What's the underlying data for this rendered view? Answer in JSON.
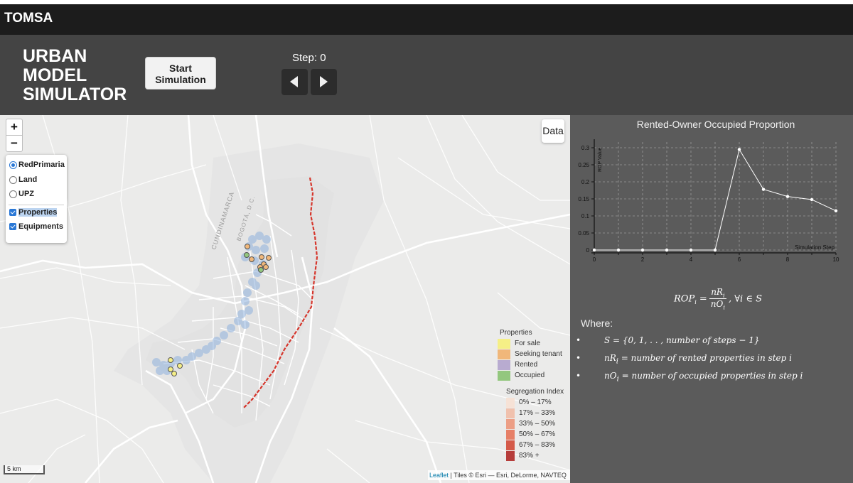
{
  "brand": "TOMSA",
  "app_title": [
    "URBAN",
    "MODEL",
    "SIMULATOR"
  ],
  "start_button": [
    "Start",
    "Simulation"
  ],
  "step_label": "Step: 0",
  "zoom": {
    "in": "+",
    "out": "−"
  },
  "layers": {
    "base": [
      {
        "label": "RedPrimaria",
        "selected": true
      },
      {
        "label": "Land",
        "selected": false
      },
      {
        "label": "UPZ",
        "selected": false
      }
    ],
    "overlays": [
      {
        "label": "Properties",
        "checked": true
      },
      {
        "label": "Equipments",
        "checked": true
      }
    ]
  },
  "data_button": "Data",
  "map_labels": {
    "region": "CUNDINAMARCA",
    "city": "BOGOTÁ, D.C."
  },
  "legend": {
    "properties_title": "Properties",
    "properties": [
      {
        "label": "For sale",
        "color": "#f5ef86"
      },
      {
        "label": "Seeking tenant",
        "color": "#f0b77a"
      },
      {
        "label": "Rented",
        "color": "#b8abd0"
      },
      {
        "label": "Occupied",
        "color": "#93c77e"
      }
    ],
    "segregation_title": "Segregation Index",
    "segregation": [
      {
        "label": "0% – 17%",
        "color": "#f6e2d6"
      },
      {
        "label": "17% – 33%",
        "color": "#f0c1ad"
      },
      {
        "label": "33% – 50%",
        "color": "#ec9e85"
      },
      {
        "label": "50% – 67%",
        "color": "#e67f66"
      },
      {
        "label": "67% – 83%",
        "color": "#d45a49"
      },
      {
        "label": "83% +",
        "color": "#b63d3b"
      }
    ]
  },
  "scale": "5 km",
  "attribution": {
    "leaflet": "Leaflet",
    "rest": " | Tiles © Esri — Esri, DeLorme, NAVTEQ"
  },
  "chart_data": {
    "type": "line",
    "title": "Rented-Owner Occupied Proportion",
    "xlabel": "Simulation Step",
    "ylabel": "ROP Value",
    "x": [
      0,
      1,
      2,
      3,
      4,
      5,
      6,
      7,
      8,
      9,
      10
    ],
    "series": [
      {
        "values": [
          0,
          0,
          0,
          0,
          0,
          0,
          0.295,
          0.178,
          0.157,
          0.148,
          0.115
        ]
      }
    ],
    "xticks": [
      "0",
      "2",
      "4",
      "6",
      "8",
      "10"
    ],
    "yticks": [
      "0",
      "0.05",
      "0.1",
      "0.15",
      "0.2",
      "0.25",
      "0.3"
    ],
    "xlim": [
      0,
      10
    ],
    "ylim": [
      0,
      0.3
    ],
    "grid": true,
    "line_color": "#ffffff"
  },
  "formula": {
    "lhs": "ROP",
    "lhs_sub": "i",
    "num": "nR",
    "num_sub": "i",
    "den": "nO",
    "den_sub": "i",
    "rest": ", ∀i ∈ S"
  },
  "where_label": "Where:",
  "definitions": [
    {
      "bullet": "•",
      "text": "S = {0, 1, . . , number of steps − 1}"
    },
    {
      "bullet": "•",
      "text": "nR",
      "sub": "i",
      "rest": " = number of rented properties in step i"
    },
    {
      "bullet": "•",
      "text": "nO",
      "sub": "i",
      "rest": " = number of occupied properties in step i"
    }
  ]
}
